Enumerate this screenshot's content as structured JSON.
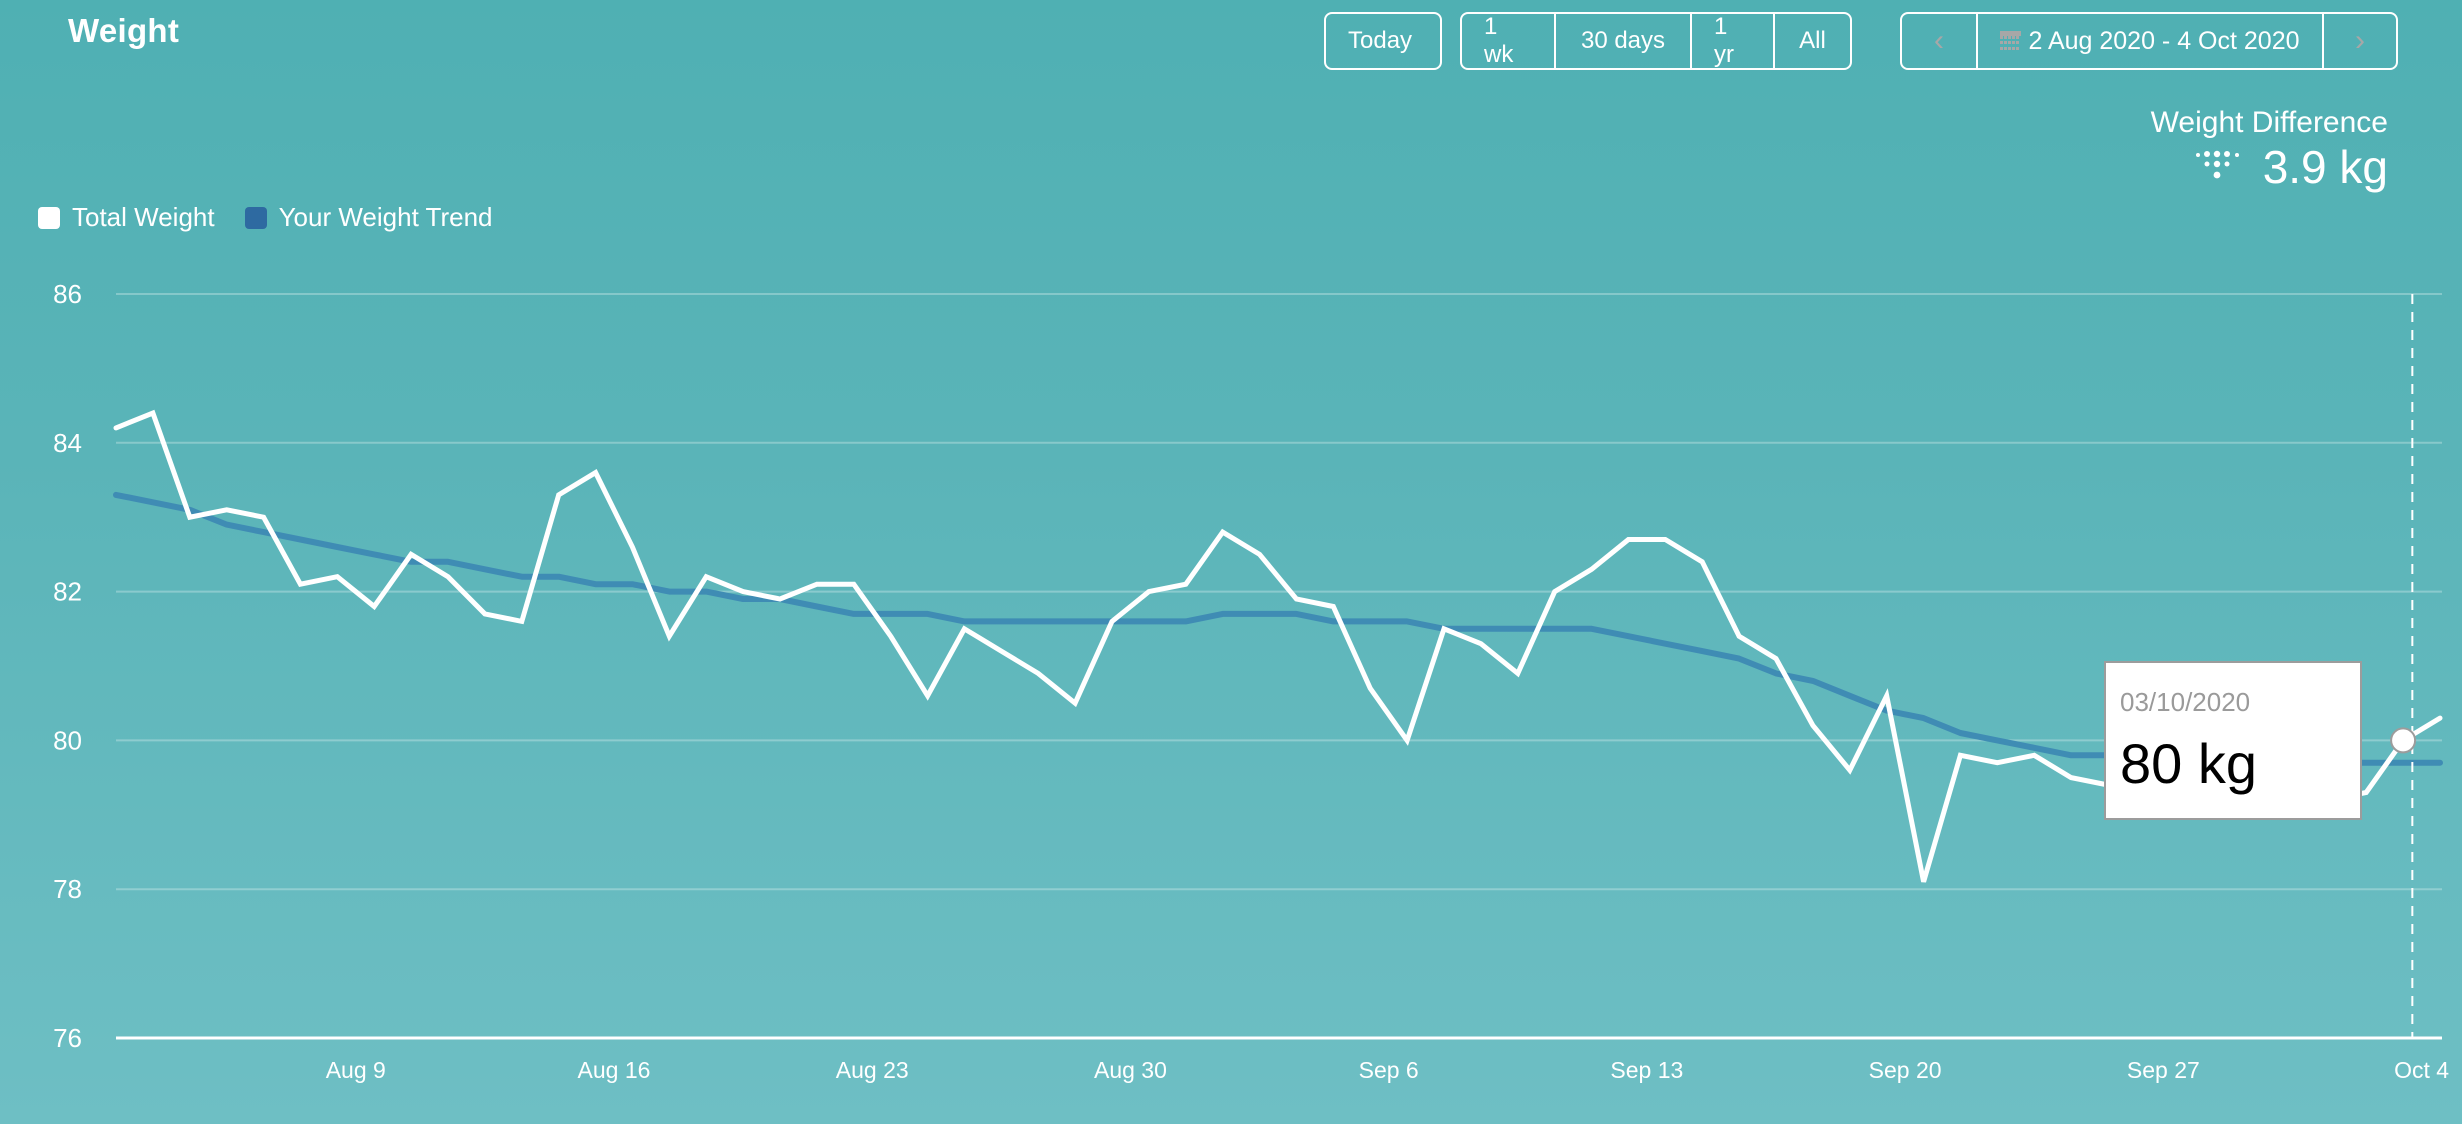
{
  "header": {
    "title": "Weight",
    "today_label": "Today",
    "ranges": [
      "1 wk",
      "30 days",
      "1 yr",
      "All"
    ],
    "date_range": "2 Aug 2020 - 4 Oct 2020",
    "prev_icon": "chevron-left-icon",
    "next_icon": "chevron-right-icon",
    "calendar_icon": "calendar-icon"
  },
  "summary": {
    "label": "Weight Difference",
    "icon": "fitbit-logo-icon",
    "value": "3.9 kg"
  },
  "colors": {
    "total_weight": "#ffffff",
    "trend": "#2e6aa1",
    "trend_line": "#3f8cb4",
    "grid": "rgba(255,255,255,0.28)"
  },
  "tooltip": {
    "date": "03/10/2020",
    "value": "80 kg",
    "point_index": 62
  },
  "chart_data": {
    "type": "line",
    "title": "Weight",
    "xlabel": "",
    "ylabel": "",
    "ylim": [
      76,
      86
    ],
    "yticks": [
      76,
      78,
      80,
      82,
      84,
      86
    ],
    "x_start": "2020-08-02",
    "x_end": "2020-10-04",
    "xtick_labels": [
      "Aug 9",
      "Aug 16",
      "Aug 23",
      "Aug 30",
      "Sep 6",
      "Sep 13",
      "Sep 20",
      "Sep 27",
      "Oct 4"
    ],
    "xtick_day_index": [
      7,
      14,
      21,
      28,
      35,
      42,
      49,
      56,
      63
    ],
    "grid": true,
    "legend": "top-left",
    "legend_entries": [
      "Total Weight",
      "Your Weight Trend"
    ],
    "series": [
      {
        "name": "Total Weight",
        "values": [
          84.2,
          84.4,
          83.0,
          83.1,
          83.0,
          82.1,
          82.2,
          81.8,
          82.5,
          82.2,
          81.7,
          81.6,
          83.3,
          83.6,
          82.6,
          81.4,
          82.2,
          82.0,
          81.9,
          82.1,
          82.1,
          81.4,
          80.6,
          81.5,
          81.2,
          80.9,
          80.5,
          81.6,
          82.0,
          82.1,
          82.8,
          82.5,
          81.9,
          81.8,
          80.7,
          80.0,
          81.5,
          81.3,
          80.9,
          82.0,
          82.3,
          82.7,
          82.7,
          82.4,
          81.4,
          81.1,
          80.2,
          79.6,
          80.6,
          78.1,
          79.8,
          79.7,
          79.8,
          79.5,
          79.4,
          79.3,
          79.2,
          79.3,
          79.4,
          79.3,
          79.2,
          79.3,
          80.0,
          80.3
        ]
      },
      {
        "name": "Your Weight Trend",
        "values": [
          83.3,
          83.2,
          83.1,
          82.9,
          82.8,
          82.7,
          82.6,
          82.5,
          82.4,
          82.4,
          82.3,
          82.2,
          82.2,
          82.1,
          82.1,
          82.0,
          82.0,
          81.9,
          81.9,
          81.8,
          81.7,
          81.7,
          81.7,
          81.6,
          81.6,
          81.6,
          81.6,
          81.6,
          81.6,
          81.6,
          81.7,
          81.7,
          81.7,
          81.6,
          81.6,
          81.6,
          81.5,
          81.5,
          81.5,
          81.5,
          81.5,
          81.4,
          81.3,
          81.2,
          81.1,
          80.9,
          80.8,
          80.6,
          80.4,
          80.3,
          80.1,
          80.0,
          79.9,
          79.8,
          79.8,
          79.7,
          79.7,
          79.7,
          79.7,
          79.7,
          79.7,
          79.7,
          79.7,
          79.7
        ]
      }
    ]
  }
}
